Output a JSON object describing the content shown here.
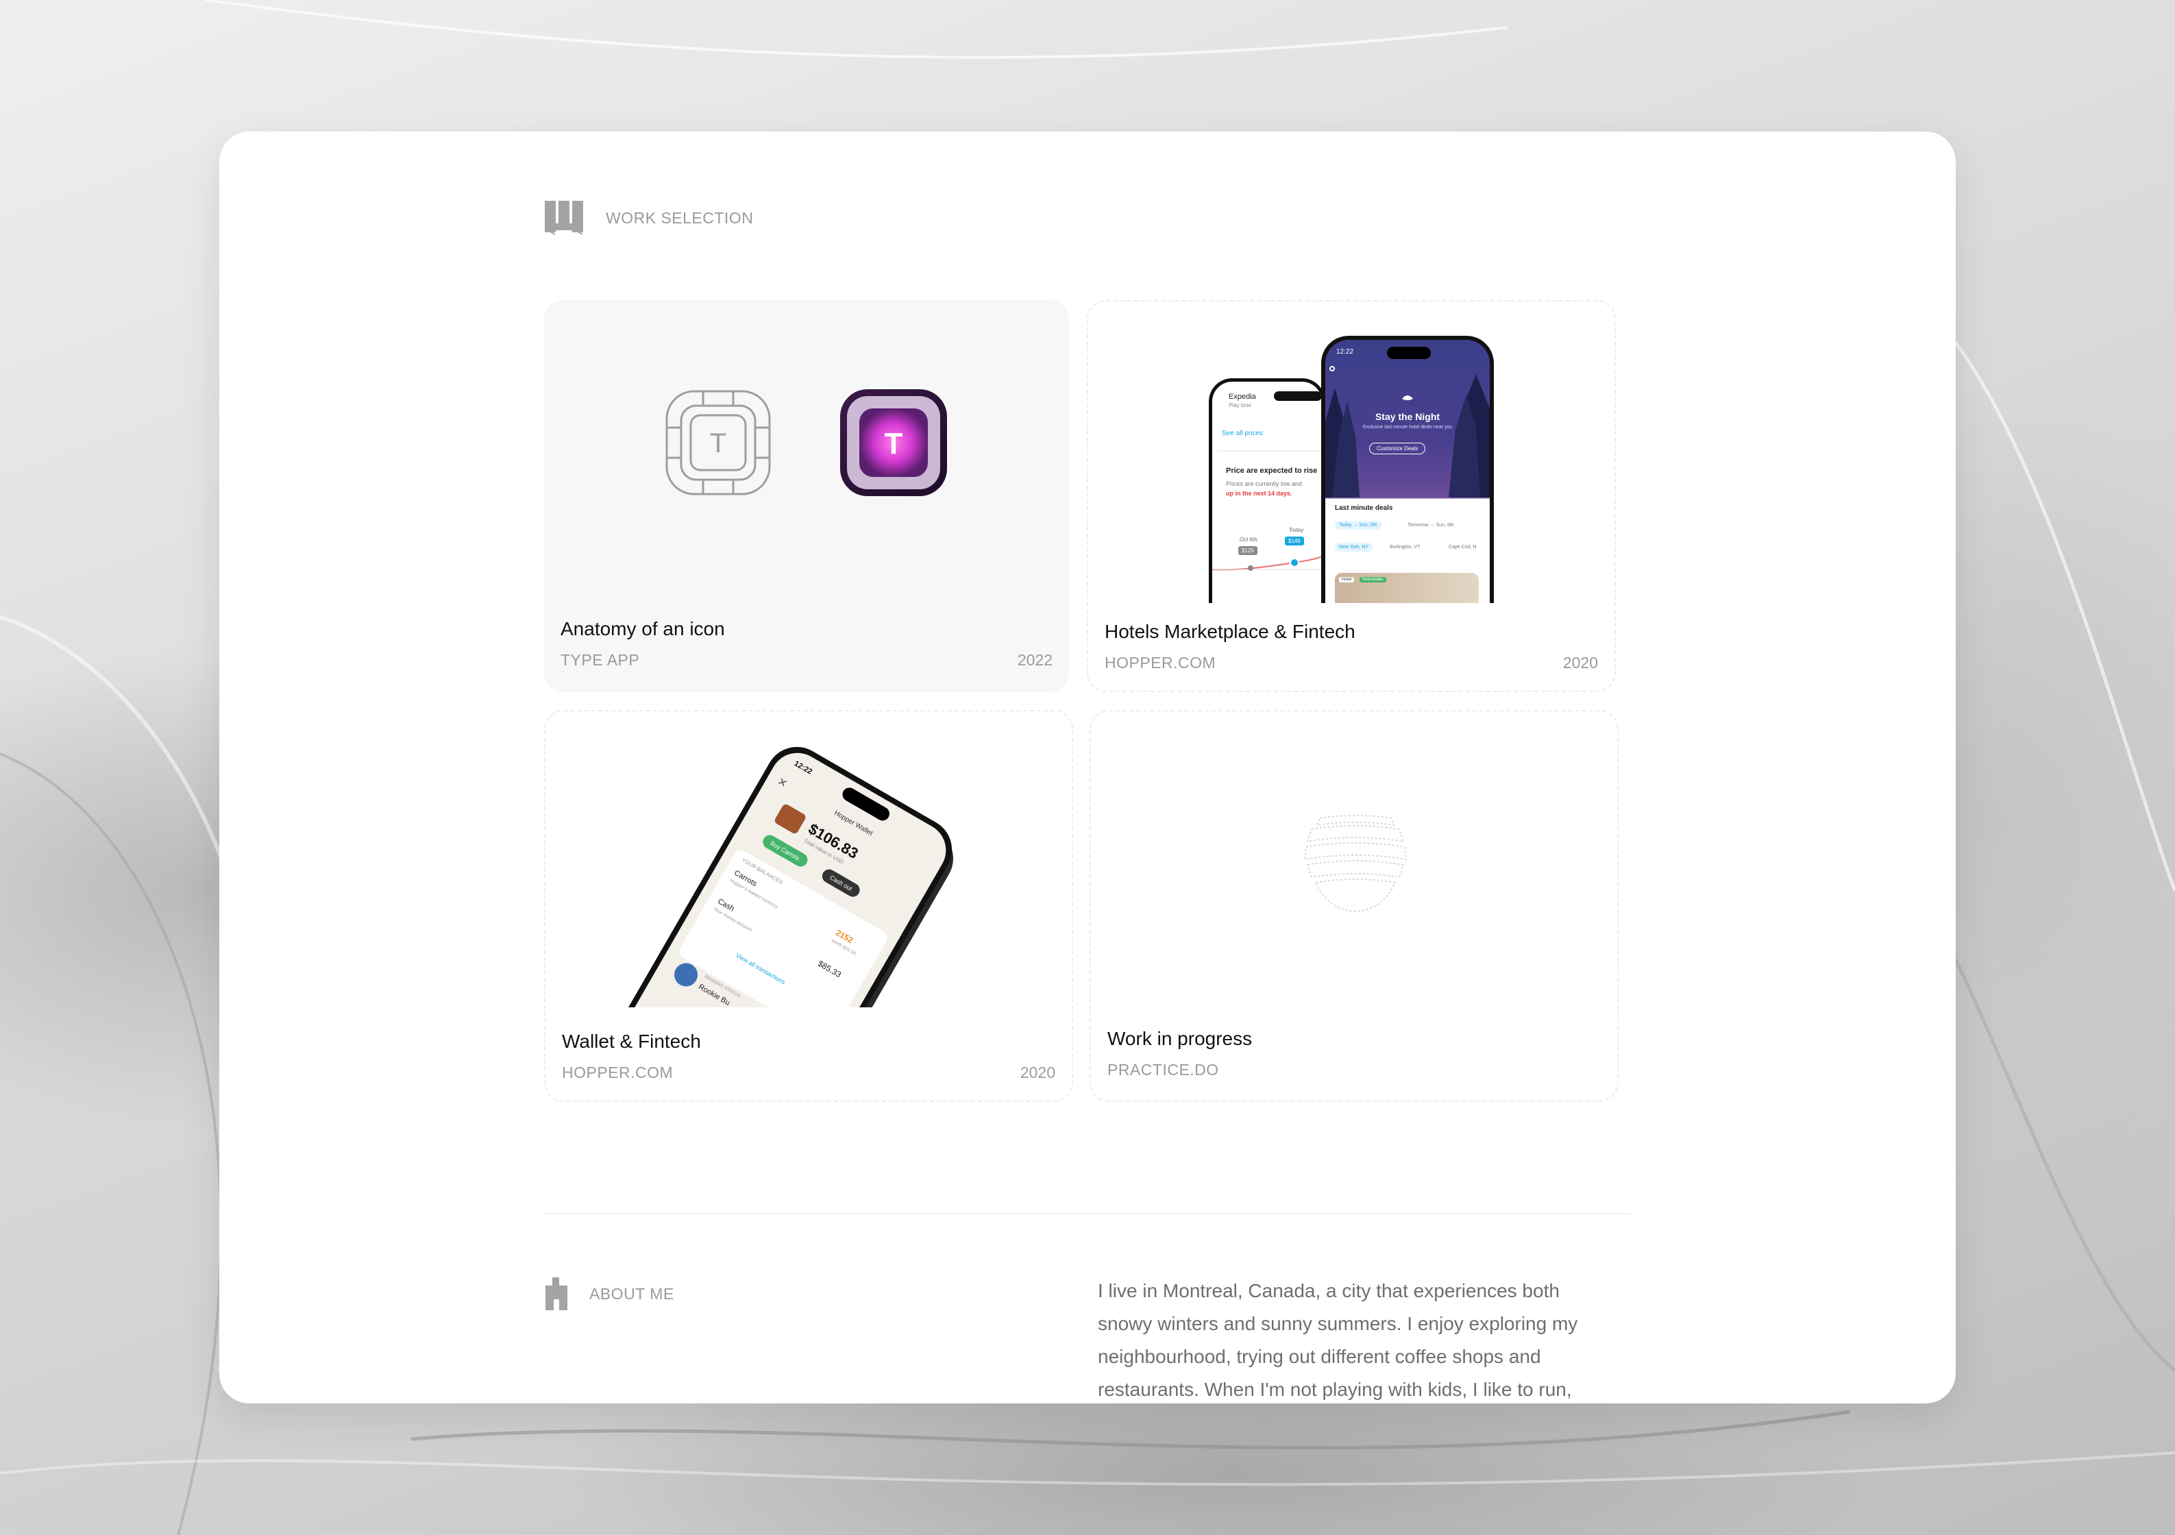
{
  "work": {
    "section_label": "WORK SELECTION",
    "projects": [
      {
        "title": "Anatomy of an icon",
        "client": "TYPE APP",
        "year": "2022"
      },
      {
        "title": "Hotels Marketplace & Fintech",
        "client": "HOPPER.COM",
        "year": "2020"
      },
      {
        "title": "Wallet & Fintech",
        "client": "HOPPER.COM",
        "year": "2020"
      },
      {
        "title": "Work in progress",
        "client": "PRACTICE.DO",
        "year": ""
      }
    ]
  },
  "hotels_phone": {
    "front_time": "12:22",
    "back_brand": "Expedia",
    "back_sub": "Play time",
    "see_all": "See all prices",
    "warning_title": "Price are expected to rise",
    "warning_body": "Prices are currently low and",
    "warning_red": "up in the next 14 days.",
    "label_oct": "Oct 6th",
    "label_today": "Today",
    "price_old": "$125",
    "price_today": "$146",
    "headline": "Stay the Night",
    "headline_sub": "Exclusive last minute hotel deals near you",
    "customize": "Customize Deals",
    "deals_title": "Last minute deals",
    "chip_1": "Today → Sun, 6th",
    "chip_2": "Tomorrow → Sun, 6th",
    "city_1": "New York, NY",
    "city_2": "Burlington, VT",
    "city_3": "Cape Cod, N",
    "badge_1": "Hotel",
    "badge_2": "Refundable"
  },
  "wallet_phone": {
    "time": "12:22",
    "title": "Hopper Wallet",
    "balance": "$106.83",
    "balance_sub": "Total value in USD",
    "btn_buy": "Buy Carrots",
    "btn_cash": "Cash out",
    "balances_label": "YOUR BALANCES",
    "carrots_label": "Carrots",
    "carrots_sub": "Hopper's reward currency",
    "carrots_value": "2152",
    "carrots_worth": "worth $21.50",
    "cash_label": "Cash",
    "cash_sub": "Your money account",
    "cash_value": "$85.33",
    "view_all": "View all transactions",
    "reward_status": "REWARD STATUS",
    "reward_name": "Rookie Bu"
  },
  "about": {
    "section_label": "ABOUT ME",
    "text": "I live in Montreal, Canada, a city that experiences both snowy winters and sunny summers. I enjoy exploring my neighbourhood, trying out different coffee shops and restaurants. When I'm not playing with kids, I like to run,"
  },
  "colors": {
    "accent_pink": "#e23ad8",
    "hopper_blue": "#1aa7e0",
    "wallet_green": "#45b36b"
  }
}
